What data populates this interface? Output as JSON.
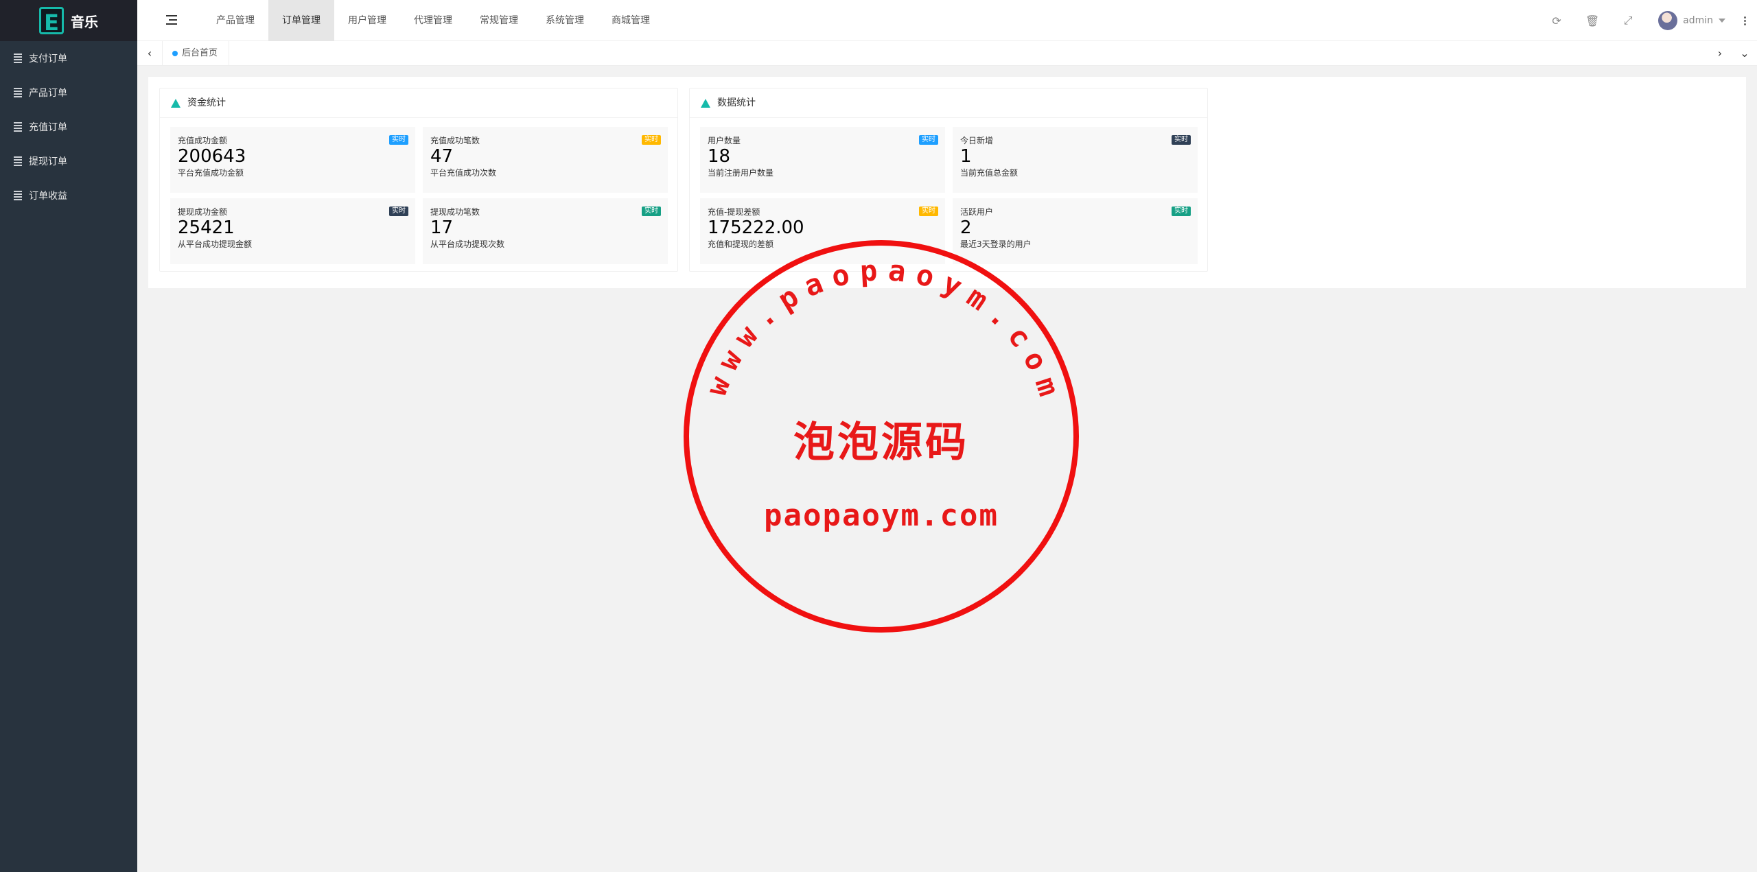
{
  "app": {
    "logo_letter": "E",
    "name": "音乐"
  },
  "sidebar": {
    "items": [
      {
        "label": "支付订单"
      },
      {
        "label": "产品订单"
      },
      {
        "label": "充值订单"
      },
      {
        "label": "提现订单"
      },
      {
        "label": "订单收益"
      }
    ]
  },
  "header": {
    "nav": [
      {
        "label": "产品管理"
      },
      {
        "label": "订单管理",
        "active": true
      },
      {
        "label": "用户管理"
      },
      {
        "label": "代理管理"
      },
      {
        "label": "常规管理"
      },
      {
        "label": "系统管理"
      },
      {
        "label": "商城管理"
      }
    ],
    "user": "admin"
  },
  "tabs": {
    "home": "后台首页"
  },
  "funds": {
    "title": "资金统计",
    "stats": [
      {
        "label": "充值成功金额",
        "value": "200643",
        "desc": "平台充值成功金额",
        "badge": "实时",
        "badge_color": "#1e9fff"
      },
      {
        "label": "充值成功笔数",
        "value": "47",
        "desc": "平台充值成功次数",
        "badge": "实时",
        "badge_color": "#ffb800"
      },
      {
        "label": "提现成功金额",
        "value": "25421",
        "desc": "从平台成功提现金额",
        "badge": "实时",
        "badge_color": "#2f4056"
      },
      {
        "label": "提现成功笔数",
        "value": "17",
        "desc": "从平台成功提现次数",
        "badge": "实时",
        "badge_color": "#16a085"
      }
    ]
  },
  "data": {
    "title": "数据统计",
    "stats": [
      {
        "label": "用户数量",
        "value": "18",
        "desc": "当前注册用户数量",
        "badge": "实时",
        "badge_color": "#1e9fff"
      },
      {
        "label": "今日新增",
        "value": "1",
        "desc": "当前充值总金额",
        "badge": "实时",
        "badge_color": "#2f4056"
      },
      {
        "label": "充值-提现差额",
        "value": "175222.00",
        "desc": "充值和提现的差额",
        "badge": "实时",
        "badge_color": "#ffb800"
      },
      {
        "label": "活跃用户",
        "value": "2",
        "desc": "最近3天登录的用户",
        "badge": "实时",
        "badge_color": "#16a085"
      }
    ]
  },
  "watermark": {
    "arc_text": "www.paopaoym.com",
    "main": "泡泡源码",
    "sub": "paopaoym.com"
  }
}
